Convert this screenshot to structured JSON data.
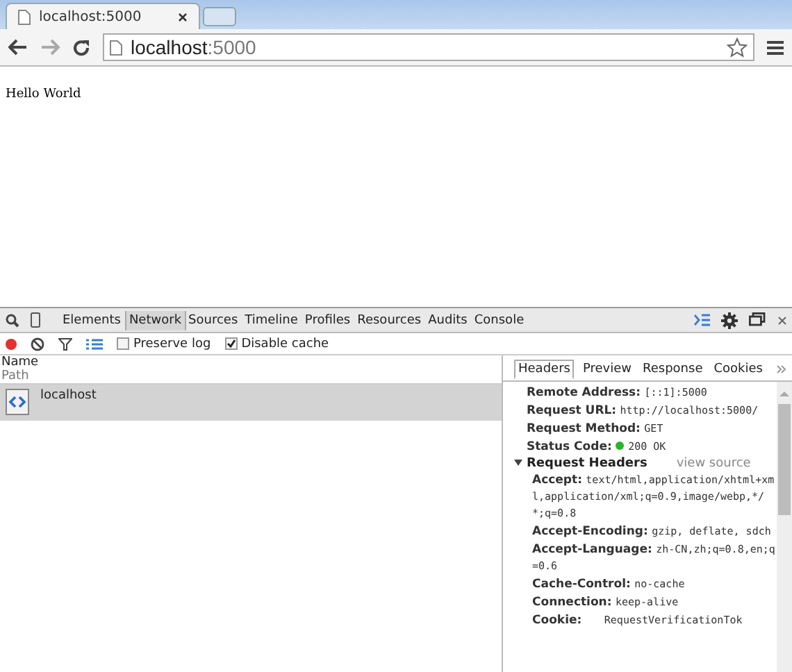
{
  "browser_tabs": [
    {
      "title": "localhost:5000",
      "selected": true
    }
  ],
  "address_bar": {
    "host": "localhost",
    "port": ":5000"
  },
  "page": {
    "text": "Hello World"
  },
  "devtools": {
    "panels": [
      {
        "label": "Elements",
        "selected": false
      },
      {
        "label": "Network",
        "selected": true
      },
      {
        "label": "Sources",
        "selected": false
      },
      {
        "label": "Timeline",
        "selected": false
      },
      {
        "label": "Profiles",
        "selected": false
      },
      {
        "label": "Resources",
        "selected": false
      },
      {
        "label": "Audits",
        "selected": false
      },
      {
        "label": "Console",
        "selected": false
      }
    ],
    "options": [
      {
        "label": "Preserve log",
        "checked": false
      },
      {
        "label": "Disable cache",
        "checked": true
      }
    ],
    "columns": {
      "name": "Name",
      "path": "Path"
    },
    "requests": [
      {
        "name": "localhost",
        "selected": true
      }
    ],
    "detail_tabs": [
      {
        "label": "Headers",
        "selected": true
      },
      {
        "label": "Preview",
        "selected": false
      },
      {
        "label": "Response",
        "selected": false
      },
      {
        "label": "Cookies",
        "selected": false
      }
    ],
    "general": [
      {
        "kind": "plain",
        "name": "Remote Address:",
        "value": "[::1]:5000"
      },
      {
        "kind": "plain",
        "name": "Request URL:",
        "value": "http://localhost:5000/"
      },
      {
        "kind": "plain",
        "name": "Request Method:",
        "value": "GET"
      },
      {
        "kind": "status",
        "name": "Status Code:",
        "value": "200 OK"
      }
    ],
    "request_headers": {
      "title": "Request Headers",
      "expanded": true,
      "link": "view source",
      "items": [
        {
          "name": "Accept:",
          "value": "text/html,application/xhtml+xml,application/xml;q=0.9,image/webp,*/*;q=0.8"
        },
        {
          "name": "Accept-Encoding:",
          "value": "gzip, deflate, sdch"
        },
        {
          "name": "Accept-Language:",
          "value": "zh-CN,zh;q=0.8,en;q=0.6"
        },
        {
          "name": "Cache-Control:",
          "value": "no-cache"
        },
        {
          "name": "Connection:",
          "value": "keep-alive"
        },
        {
          "name": "Cookie:",
          "value": "   RequestVerificationTok"
        }
      ]
    }
  }
}
